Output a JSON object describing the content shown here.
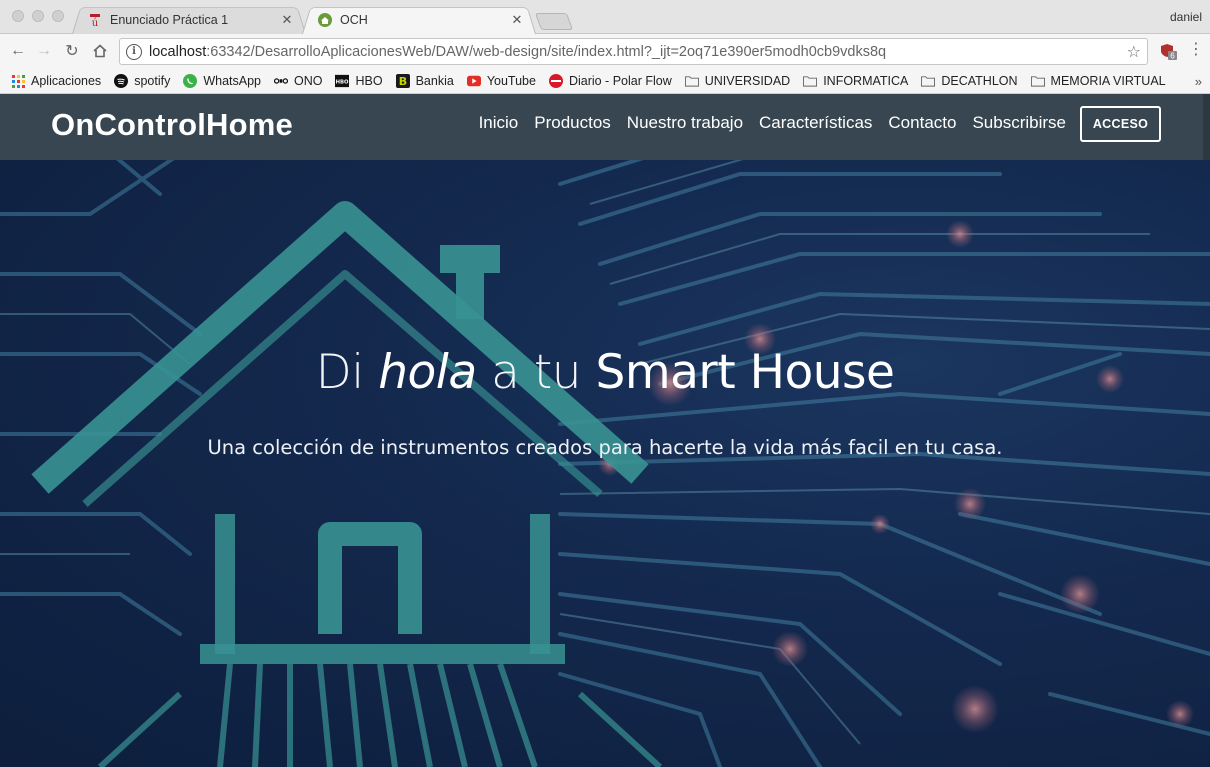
{
  "browser": {
    "tabs": [
      {
        "title": "Enunciado Práctica 1",
        "favicon": "university-logo-icon",
        "active": false
      },
      {
        "title": "OCH",
        "favicon": "home-icon",
        "active": true
      }
    ],
    "profile_name": "daniel",
    "url": {
      "host": "localhost",
      "rest": ":63342/DesarrolloAplicacionesWeb/DAW/web-design/site/index.html?_ijt=2oq71e390er5modh0cb9vdks8q"
    },
    "extension_badge": "6",
    "bookmarks": [
      {
        "label": "Aplicaciones",
        "icon": "apps-grid-icon"
      },
      {
        "label": "spotify",
        "icon": "spotify-icon"
      },
      {
        "label": "WhatsApp",
        "icon": "whatsapp-icon"
      },
      {
        "label": "ONO",
        "icon": "ono-icon"
      },
      {
        "label": "HBO",
        "icon": "hbo-icon"
      },
      {
        "label": "Bankia",
        "icon": "bankia-icon"
      },
      {
        "label": "YouTube",
        "icon": "youtube-icon"
      },
      {
        "label": "Diario - Polar Flow",
        "icon": "polar-icon"
      },
      {
        "label": "UNIVERSIDAD",
        "icon": "folder-icon"
      },
      {
        "label": "INFORMATICA",
        "icon": "folder-icon"
      },
      {
        "label": "DECATHLON",
        "icon": "folder-icon"
      },
      {
        "label": "MEMORIA VIRTUAL",
        "icon": "folder-icon"
      }
    ],
    "bookmarks_overflow": "»"
  },
  "site": {
    "brand": "OnControlHome",
    "nav": [
      "Inicio",
      "Productos",
      "Nuestro trabajo",
      "Características",
      "Contacto",
      "Subscribirse"
    ],
    "login_label": "ACCESO",
    "hero": {
      "title_part1": "Di ",
      "title_italic": "hola",
      "title_part2": " a tu ",
      "title_bold": "Smart House",
      "subtitle": "Una colección de instrumentos creados para hacerte la vida más facil en tu casa."
    }
  },
  "colors": {
    "nav_bg": "#374650",
    "hero_bg": "#142b52",
    "circuit": "#3fa6a2"
  }
}
